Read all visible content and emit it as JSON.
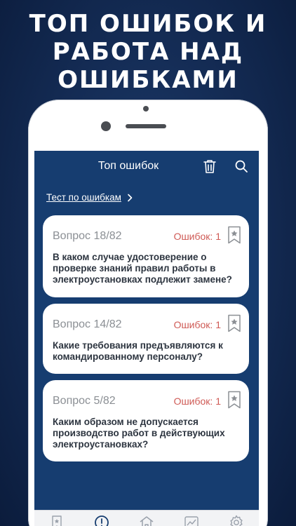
{
  "promo": {
    "headline_line1": "ТОП ОШИБОК И",
    "headline_line2": "РАБОТА НАД",
    "headline_line3": "ОШИБКАМИ"
  },
  "navbar": {
    "title": "Топ ошибок",
    "icons": [
      "trash-icon",
      "search-icon"
    ]
  },
  "test_link": {
    "label": "Тест по ошибкам",
    "icon": "chevron-right-icon"
  },
  "questions": [
    {
      "number_label": "Вопрос 18/82",
      "errors_label": "Ошибок: 1",
      "text_lines": [
        "В каком случае удостоверение о",
        "проверке знаний правил работы в",
        "электроустановках подлежит замене?"
      ]
    },
    {
      "number_label": "Вопрос 14/82",
      "errors_label": "Ошибок: 1",
      "text_lines": [
        "Какие требования предъявляются к",
        "командированному персоналу?"
      ]
    },
    {
      "number_label": "Вопрос 5/82",
      "errors_label": "Ошибок: 1",
      "text_lines": [
        "Каким образом не допускается",
        "производство работ в действующих",
        "электроустановках?"
      ]
    }
  ],
  "tabbar": {
    "items": [
      "bookmark-icon",
      "mistakes-icon",
      "home-icon",
      "statistics-icon",
      "settings-icon"
    ]
  },
  "colors": {
    "background": "#132a52",
    "screen": "#163d70",
    "card": "#ffffff",
    "error_text": "#cf5a55",
    "question_number": "#8b8f94",
    "question_text": "#2d3540",
    "active_tab": "#163d70",
    "inactive_tab": "#9aa1ab"
  }
}
